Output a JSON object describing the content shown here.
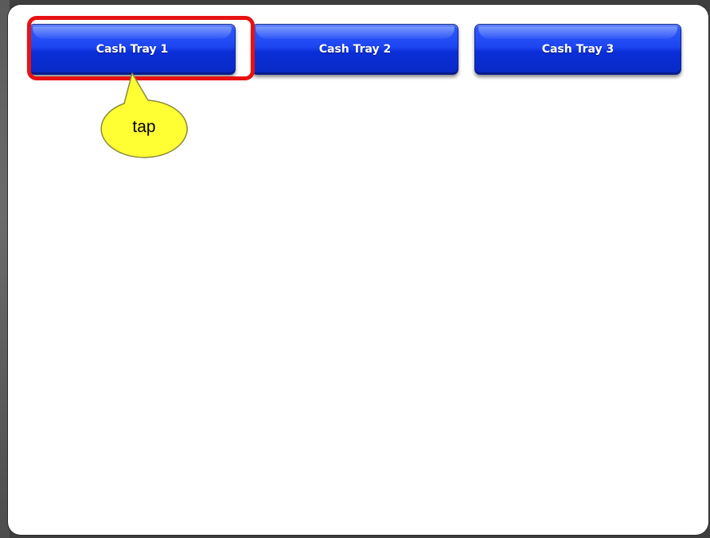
{
  "dialog": {
    "buttons": [
      {
        "label": "Cash Tray 1"
      },
      {
        "label": "Cash Tray 2"
      },
      {
        "label": "Cash Tray 3"
      }
    ]
  },
  "annotation": {
    "callout_text": "tap",
    "highlight_color": "#e81212",
    "callout_fill": "#ffff33",
    "callout_stroke": "#8a8a3a"
  },
  "colors": {
    "button_blue": "#1d45f0",
    "button_text": "#ffffff",
    "dialog_background": "#ffffff",
    "backdrop": "#3e3e3e"
  }
}
